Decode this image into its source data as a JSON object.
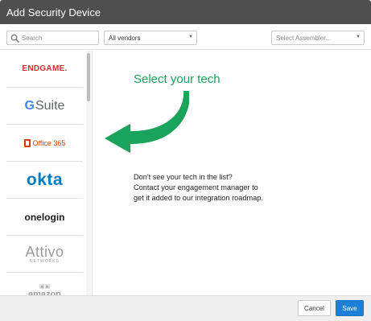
{
  "window": {
    "title": "Add Security Device"
  },
  "toolbar": {
    "search": {
      "placeholder": "Search",
      "value": ""
    },
    "vendor_select": {
      "selected": "All vendors"
    },
    "assembler_select": {
      "placeholder": "Select Assembler..."
    }
  },
  "logos": [
    {
      "name": "ENDGAME."
    },
    {
      "g": "G",
      "name": "Suite"
    },
    {
      "name": "Office 365"
    },
    {
      "name": "okta"
    },
    {
      "name": "onelogin"
    },
    {
      "name": "Attivo",
      "sub": "NETWORKS"
    },
    {
      "name": "amazon"
    }
  ],
  "main": {
    "prompt": "Select your tech",
    "help_lines": [
      "Don't see your tech in the list?",
      "Contact your engagement manager to",
      "get it added to our integration roadmap."
    ]
  },
  "footer": {
    "cancel_label": "Cancel",
    "save_label": "Save"
  },
  "colors": {
    "titlebar": "#4f4f4f",
    "accent_green": "#1aa35a",
    "save_blue": "#1e7fd6"
  },
  "icons": [
    "search-icon",
    "chevron-down-icon",
    "curved-arrow-icon"
  ]
}
